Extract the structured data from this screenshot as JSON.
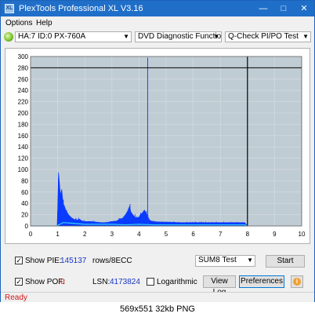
{
  "window": {
    "title": "PlexTools Professional XL V3.16",
    "icon": "XL"
  },
  "menu": {
    "items": [
      "Options",
      "Help"
    ]
  },
  "toolbar": {
    "drive": "HA:7 ID:0  PX-760A",
    "function": "DVD Diagnostic Functions",
    "test": "Q-Check PI/PO Test"
  },
  "chart_data": {
    "type": "area",
    "xlim": [
      0,
      10
    ],
    "ylim": [
      0,
      300
    ],
    "x_ticks": [
      "0",
      "1",
      "2",
      "3",
      "4",
      "5",
      "6",
      "7",
      "8",
      "9",
      "10"
    ],
    "y_ticks": [
      "0",
      "20",
      "40",
      "60",
      "80",
      "100",
      "120",
      "140",
      "160",
      "180",
      "200",
      "220",
      "240",
      "260",
      "280",
      "300"
    ],
    "grid": true,
    "end_marker_x": 8,
    "reference_line_y": 280,
    "colors": {
      "pie_fill": "#0a3cff",
      "po_line": "#30d0ff",
      "spike": "#2040ff",
      "background": "#c0ccd4",
      "grid": "#d8dde0",
      "marker": "#000000"
    },
    "pie_envelope": [
      [
        0.0,
        0
      ],
      [
        0.98,
        0
      ],
      [
        1.0,
        30
      ],
      [
        1.03,
        95
      ],
      [
        1.06,
        80
      ],
      [
        1.1,
        55
      ],
      [
        1.15,
        65
      ],
      [
        1.2,
        40
      ],
      [
        1.25,
        35
      ],
      [
        1.3,
        28
      ],
      [
        1.4,
        20
      ],
      [
        1.5,
        15
      ],
      [
        1.6,
        12
      ],
      [
        1.7,
        10
      ],
      [
        1.8,
        12
      ],
      [
        1.9,
        9
      ],
      [
        2.0,
        8
      ],
      [
        2.2,
        8
      ],
      [
        2.4,
        7
      ],
      [
        2.6,
        6
      ],
      [
        2.8,
        6
      ],
      [
        3.0,
        8
      ],
      [
        3.2,
        9
      ],
      [
        3.4,
        14
      ],
      [
        3.5,
        20
      ],
      [
        3.6,
        28
      ],
      [
        3.65,
        35
      ],
      [
        3.7,
        25
      ],
      [
        3.8,
        18
      ],
      [
        3.9,
        14
      ],
      [
        4.0,
        16
      ],
      [
        4.1,
        22
      ],
      [
        4.2,
        28
      ],
      [
        4.3,
        20
      ],
      [
        4.35,
        14
      ],
      [
        4.4,
        10
      ],
      [
        4.5,
        8
      ],
      [
        4.8,
        7
      ],
      [
        5.0,
        7
      ],
      [
        5.5,
        6
      ],
      [
        6.0,
        6
      ],
      [
        6.5,
        6
      ],
      [
        7.0,
        6
      ],
      [
        7.5,
        6
      ],
      [
        7.9,
        6
      ],
      [
        8.0,
        0
      ]
    ],
    "po_envelope": [
      [
        0.98,
        0
      ],
      [
        1.0,
        1
      ],
      [
        1.2,
        6
      ],
      [
        1.5,
        5
      ],
      [
        2.0,
        3
      ],
      [
        3.0,
        3
      ],
      [
        3.5,
        2
      ],
      [
        4.0,
        3
      ],
      [
        4.5,
        2
      ],
      [
        5.0,
        2
      ],
      [
        6.0,
        2
      ],
      [
        7.0,
        2
      ],
      [
        7.9,
        2
      ],
      [
        8.0,
        0
      ]
    ],
    "spike_peak": {
      "x": 4.32,
      "y": 298
    }
  },
  "stats": {
    "show_pie_label": "Show PIE:",
    "pie_value": "145137",
    "pie_unit": "rows/8ECC",
    "show_pof_label": "Show POF:",
    "pof_value": "0",
    "lsn_label": "LSN:",
    "lsn_value": "4173824",
    "logarithmic_label": "Logarithmic"
  },
  "controls": {
    "sum_select": "SUM8 Test",
    "start_label": "Start",
    "view_log_label": "View Log",
    "preferences_label": "Preferences"
  },
  "status": {
    "text": "Ready"
  },
  "caption": "569x551 32kb PNG"
}
